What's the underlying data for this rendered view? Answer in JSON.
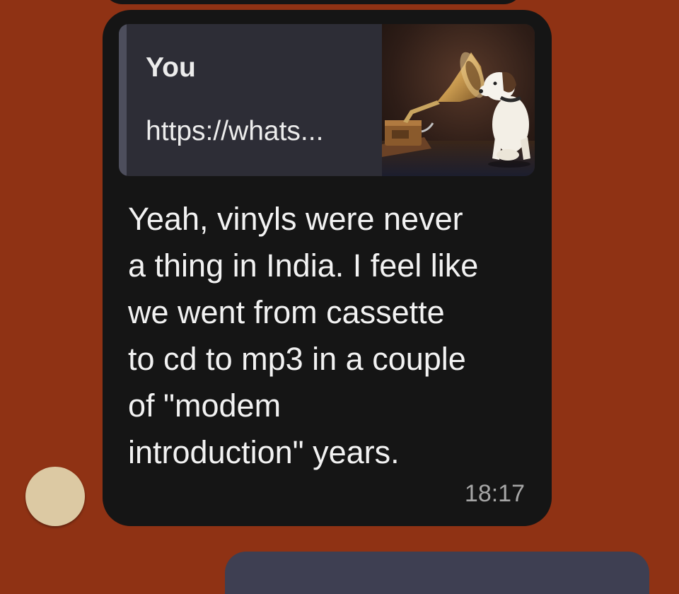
{
  "message": {
    "quote": {
      "author": "You",
      "text": "https://whats...",
      "thumbnail_icon": "gramophone-dog-image"
    },
    "text": "Yeah, vinyls were never\na thing in India. I feel like\nwe went from cassette\nto cd to mp3 in a couple\nof \"modem\nintroduction\" years.",
    "time": "18:17"
  },
  "colors": {
    "background": "#8f3214",
    "incoming_bubble": "#151515",
    "quote_background": "#2d2d36",
    "outgoing_bubble": "#3e3f52",
    "avatar": "#dcc9a3"
  }
}
